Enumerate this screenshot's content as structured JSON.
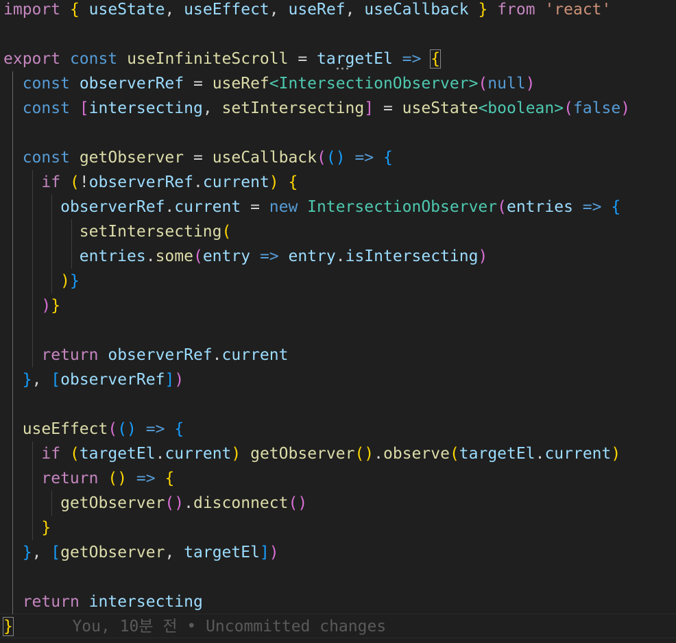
{
  "editor": {
    "background": "#1f1f1f",
    "blame_inline": "You, 10분 전 • Uncommitted changes",
    "lines": [
      [
        [
          "kw",
          "import"
        ],
        [
          "plain",
          " "
        ],
        [
          "b1",
          "{"
        ],
        [
          "plain",
          " "
        ],
        [
          "var",
          "useState"
        ],
        [
          "plain",
          ", "
        ],
        [
          "var",
          "useEffect"
        ],
        [
          "plain",
          ", "
        ],
        [
          "var",
          "useRef"
        ],
        [
          "plain",
          ", "
        ],
        [
          "var",
          "useCallback"
        ],
        [
          "plain",
          " "
        ],
        [
          "b1",
          "}"
        ],
        [
          "plain",
          " "
        ],
        [
          "kw",
          "from"
        ],
        [
          "plain",
          " "
        ],
        [
          "str",
          "'react'"
        ]
      ],
      [],
      [
        [
          "kw",
          "export"
        ],
        [
          "plain",
          " "
        ],
        [
          "st",
          "const"
        ],
        [
          "plain",
          " "
        ],
        [
          "fn",
          "useInfiniteScroll"
        ],
        [
          "plain",
          " = "
        ],
        [
          "var",
          "targetEl"
        ],
        [
          "plain",
          " "
        ],
        [
          "st",
          "=>"
        ],
        [
          "plain",
          " "
        ],
        [
          "b1",
          "{"
        ]
      ],
      [
        [
          "plain",
          "  "
        ],
        [
          "st",
          "const"
        ],
        [
          "plain",
          " "
        ],
        [
          "var",
          "observerRef"
        ],
        [
          "plain",
          " = "
        ],
        [
          "fn",
          "useRef"
        ],
        [
          "cls",
          "<IntersectionObserver>"
        ],
        [
          "b2",
          "("
        ],
        [
          "st",
          "null"
        ],
        [
          "b2",
          ")"
        ]
      ],
      [
        [
          "plain",
          "  "
        ],
        [
          "st",
          "const"
        ],
        [
          "plain",
          " "
        ],
        [
          "b2",
          "["
        ],
        [
          "var",
          "intersecting"
        ],
        [
          "plain",
          ", "
        ],
        [
          "fn",
          "setIntersecting"
        ],
        [
          "b2",
          "]"
        ],
        [
          "plain",
          " = "
        ],
        [
          "fn",
          "useState"
        ],
        [
          "cls",
          "<boolean>"
        ],
        [
          "b2",
          "("
        ],
        [
          "st",
          "false"
        ],
        [
          "b2",
          ")"
        ]
      ],
      [],
      [
        [
          "plain",
          "  "
        ],
        [
          "st",
          "const"
        ],
        [
          "plain",
          " "
        ],
        [
          "fn",
          "getObserver"
        ],
        [
          "plain",
          " = "
        ],
        [
          "fn",
          "useCallback"
        ],
        [
          "b2",
          "("
        ],
        [
          "b3",
          "()"
        ],
        [
          "plain",
          " "
        ],
        [
          "st",
          "=>"
        ],
        [
          "plain",
          " "
        ],
        [
          "b3",
          "{"
        ]
      ],
      [
        [
          "plain",
          "    "
        ],
        [
          "kw",
          "if"
        ],
        [
          "plain",
          " "
        ],
        [
          "b1",
          "("
        ],
        [
          "plain",
          "!"
        ],
        [
          "var",
          "observerRef"
        ],
        [
          "plain",
          "."
        ],
        [
          "var",
          "current"
        ],
        [
          "b1",
          ")"
        ],
        [
          "plain",
          " "
        ],
        [
          "b1",
          "{"
        ]
      ],
      [
        [
          "plain",
          "      "
        ],
        [
          "var",
          "observerRef"
        ],
        [
          "plain",
          "."
        ],
        [
          "var",
          "current"
        ],
        [
          "plain",
          " = "
        ],
        [
          "st",
          "new"
        ],
        [
          "plain",
          " "
        ],
        [
          "cls",
          "IntersectionObserver"
        ],
        [
          "b2",
          "("
        ],
        [
          "var",
          "entries"
        ],
        [
          "plain",
          " "
        ],
        [
          "st",
          "=>"
        ],
        [
          "plain",
          " "
        ],
        [
          "b3",
          "{"
        ]
      ],
      [
        [
          "plain",
          "        "
        ],
        [
          "fn",
          "setIntersecting"
        ],
        [
          "b1",
          "("
        ]
      ],
      [
        [
          "plain",
          "        "
        ],
        [
          "var",
          "entries"
        ],
        [
          "plain",
          "."
        ],
        [
          "fn",
          "some"
        ],
        [
          "b2",
          "("
        ],
        [
          "var",
          "entry"
        ],
        [
          "plain",
          " "
        ],
        [
          "st",
          "=>"
        ],
        [
          "plain",
          " "
        ],
        [
          "var",
          "entry"
        ],
        [
          "plain",
          "."
        ],
        [
          "var",
          "isIntersecting"
        ],
        [
          "b2",
          ")"
        ]
      ],
      [
        [
          "plain",
          "      "
        ],
        [
          "b1",
          ")"
        ],
        [
          "b3",
          "}"
        ]
      ],
      [
        [
          "plain",
          "    "
        ],
        [
          "b2",
          ")"
        ],
        [
          "b1",
          "}"
        ]
      ],
      [],
      [
        [
          "plain",
          "    "
        ],
        [
          "kw",
          "return"
        ],
        [
          "plain",
          " "
        ],
        [
          "var",
          "observerRef"
        ],
        [
          "plain",
          "."
        ],
        [
          "var",
          "current"
        ]
      ],
      [
        [
          "plain",
          "  "
        ],
        [
          "b3",
          "}"
        ],
        [
          "plain",
          ", "
        ],
        [
          "b3",
          "["
        ],
        [
          "var",
          "observerRef"
        ],
        [
          "b3",
          "]"
        ],
        [
          "b2",
          ")"
        ]
      ],
      [],
      [
        [
          "plain",
          "  "
        ],
        [
          "fn",
          "useEffect"
        ],
        [
          "b2",
          "("
        ],
        [
          "b3",
          "()"
        ],
        [
          "plain",
          " "
        ],
        [
          "st",
          "=>"
        ],
        [
          "plain",
          " "
        ],
        [
          "b3",
          "{"
        ]
      ],
      [
        [
          "plain",
          "    "
        ],
        [
          "kw",
          "if"
        ],
        [
          "plain",
          " "
        ],
        [
          "b1",
          "("
        ],
        [
          "var",
          "targetEl"
        ],
        [
          "plain",
          "."
        ],
        [
          "var",
          "current"
        ],
        [
          "b1",
          ")"
        ],
        [
          "plain",
          " "
        ],
        [
          "fn",
          "getObserver"
        ],
        [
          "b1",
          "()"
        ],
        [
          "plain",
          "."
        ],
        [
          "fn",
          "observe"
        ],
        [
          "b1",
          "("
        ],
        [
          "var",
          "targetEl"
        ],
        [
          "plain",
          "."
        ],
        [
          "var",
          "current"
        ],
        [
          "b1",
          ")"
        ]
      ],
      [
        [
          "plain",
          "    "
        ],
        [
          "kw",
          "return"
        ],
        [
          "plain",
          " "
        ],
        [
          "b1",
          "()"
        ],
        [
          "plain",
          " "
        ],
        [
          "st",
          "=>"
        ],
        [
          "plain",
          " "
        ],
        [
          "b1",
          "{"
        ]
      ],
      [
        [
          "plain",
          "      "
        ],
        [
          "fn",
          "getObserver"
        ],
        [
          "b2",
          "()"
        ],
        [
          "plain",
          "."
        ],
        [
          "fn",
          "disconnect"
        ],
        [
          "b2",
          "()"
        ]
      ],
      [
        [
          "plain",
          "    "
        ],
        [
          "b1",
          "}"
        ]
      ],
      [
        [
          "plain",
          "  "
        ],
        [
          "b3",
          "}"
        ],
        [
          "plain",
          ", "
        ],
        [
          "b3",
          "["
        ],
        [
          "fn",
          "getObserver"
        ],
        [
          "plain",
          ", "
        ],
        [
          "var",
          "targetEl"
        ],
        [
          "b3",
          "]"
        ],
        [
          "b2",
          ")"
        ]
      ],
      [],
      [
        [
          "plain",
          "  "
        ],
        [
          "kw",
          "return"
        ],
        [
          "plain",
          " "
        ],
        [
          "var",
          "intersecting"
        ]
      ],
      [
        [
          "b1",
          "}"
        ]
      ]
    ]
  }
}
